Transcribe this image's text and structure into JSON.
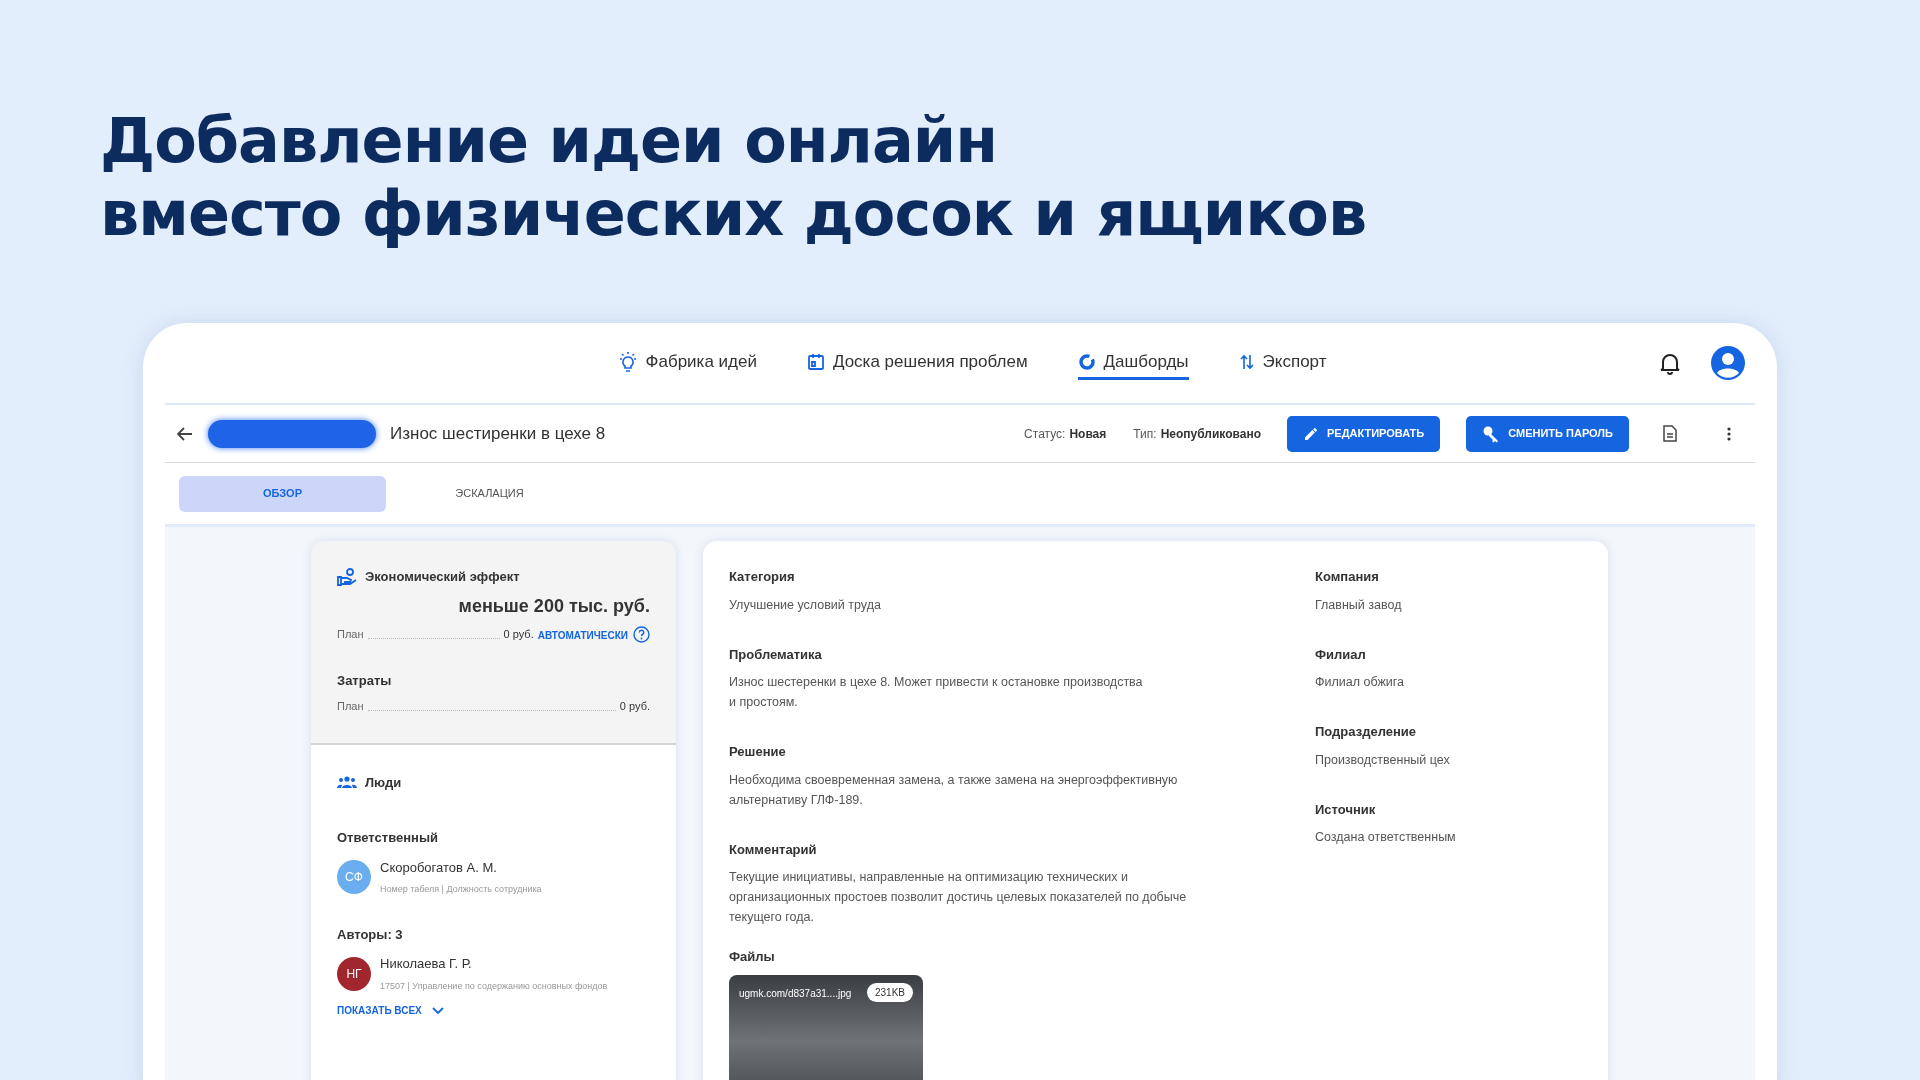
{
  "headline": [
    "Добавление идеи онлайн",
    "вместо физических досок и ящиков"
  ],
  "nav": [
    {
      "label": "Фабрика идей",
      "kind": "bulb",
      "selected": false
    },
    {
      "label": "Доска решения проблем",
      "kind": "board",
      "selected": false
    },
    {
      "label": "Дашборды",
      "kind": "chart",
      "selected": true
    },
    {
      "label": "Экспорт",
      "kind": "export",
      "selected": false
    }
  ],
  "record": {
    "title": "Износ шестиренки в цехе 8",
    "status_label": "Статус:",
    "status": "Новая",
    "type_label": "Тип:",
    "type": "Неопубликовано",
    "buttons": [
      {
        "label": "РЕДАКТИРОВАТЬ",
        "kind": "edit"
      },
      {
        "label": "СМЕНИТЬ ПАРОЛЬ",
        "kind": "key"
      }
    ]
  },
  "tabs": [
    {
      "label": "ОБЗОР",
      "selected": true
    },
    {
      "label": "ЭСКАЛАЦИЯ",
      "selected": false
    }
  ],
  "effect": {
    "title": "Экономический эффект",
    "value": "меньше 200 тыс. руб.",
    "plan_label": "План",
    "plan_value": "0 руб.",
    "auto": "АВТОМАТИЧЕСКИ",
    "costs_title": "Затраты",
    "costs_plan_label": "План",
    "costs_plan_value": "0 руб."
  },
  "people": {
    "title": "Люди",
    "responsible_label": "Ответственный",
    "responsible": {
      "initials": "СФ",
      "name": "Скоробогатов А. М.",
      "detail": "Номер табеля | Должность сотрудника",
      "color": "#6aaef0"
    },
    "authors_label": "Авторы: 3",
    "authors": [
      {
        "initials": "НГ",
        "name": "Николаева Г. Р.",
        "detail": "17507 | Управление по содержанию основных фондов",
        "color": "#a2262e"
      }
    ],
    "show_all": "ПОКАЗАТЬ ВСЕХ"
  },
  "details_left": [
    {
      "label": "Категория",
      "value": "Улучшение условий труда"
    },
    {
      "label": "Проблематика",
      "value": "Износ шестеренки в цехе 8. Может привести к остановке производства\nи простоям."
    },
    {
      "label": "Решение",
      "value": "Необходима своевременная замена, а также замена на энергоэффективную\nальтернативу ГЛФ-189."
    },
    {
      "label": "Комментарий",
      "value": "Текущие инициативы, направленные на оптимизацию технических и\nорганизационных простоев позволит достичь целевых показателей по добыче\nтекущего года."
    }
  ],
  "details_right": [
    {
      "label": "Компания",
      "value": "Главный завод"
    },
    {
      "label": "Филиал",
      "value": "Филиал обжига"
    },
    {
      "label": "Подразделение",
      "value": "Производственный цех"
    },
    {
      "label": "Источник",
      "value": "Создана ответственным"
    }
  ],
  "files": {
    "label": "Файлы",
    "items": [
      {
        "name": "ugmk.com/d837a31....jpg",
        "size": "231KB"
      }
    ]
  }
}
